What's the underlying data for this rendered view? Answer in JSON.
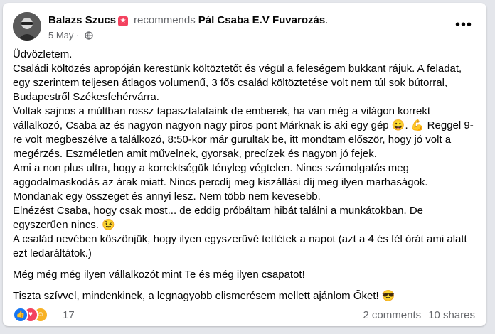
{
  "post": {
    "author": "Balazs Szucs",
    "recommends_text": "recommends",
    "page_name": "Pál Csaba E.V Fuvarozás",
    "page_suffix": ".",
    "date": "5 May",
    "date_separator": "·",
    "more_icon": "more-horizontal-icon",
    "paragraphs": [
      "Üdvözletem.",
      "Családi költözés apropóján kerestünk költöztetőt és végül a feleségem bukkant rájuk. A feladat, egy szerintem teljesen átlagos volumenű, 3 fős család költöztetése volt nem túl sok bútorral, Budapestről Székesfehérvárra.",
      "Voltak sajnos a múltban rossz tapasztalataink de emberek, ha van még a világon korrekt vállalkozó, Csaba az és nagyon nagyon nagy piros pont Márknak is aki egy gép 😀. 💪 Reggel 9-re volt megbeszélve a találkozó, 8:50-kor már gurultak be, itt mondtam először, hogy jó volt a megérzés. Eszméletlen amit művelnek, gyorsak, precízek és nagyon jó fejek.",
      "Ami a non plus ultra, hogy a korrektségük tényleg végtelen. Nincs számolgatás meg aggodalmaskodás az árak miatt. Nincs percdíj meg kiszállási díj meg ilyen marhaságok.",
      "Mondanak egy összeget és annyi lesz. Nem több nem kevesebb.",
      "Elnézést Csaba, hogy csak most... de eddig próbáltam hibát találni a munkátokban. De egyszerűen nincs. 😉",
      "A család nevében köszönjük, hogy ilyen egyszerűvé tettétek a napot (azt a 4 és fél órát ami alatt ezt ledaráltátok.)",
      "Még még még ilyen vállalkozót mint Te és még ilyen csapatot!",
      "Tiszta szívvel, mindenkinek, a legnagyobb elismerésem mellett ajánlom Őket! 😎"
    ],
    "reactions": {
      "count": "17",
      "types": [
        "like",
        "love",
        "care"
      ],
      "colors": {
        "like": "#1877f2",
        "love": "#f3425f",
        "care": "#f7b125"
      }
    },
    "comments_label": "2 comments",
    "shares_label": "10 shares"
  },
  "colors": {
    "text": "#050505",
    "secondary": "#65676b",
    "recommend_badge": "#f3425f"
  }
}
